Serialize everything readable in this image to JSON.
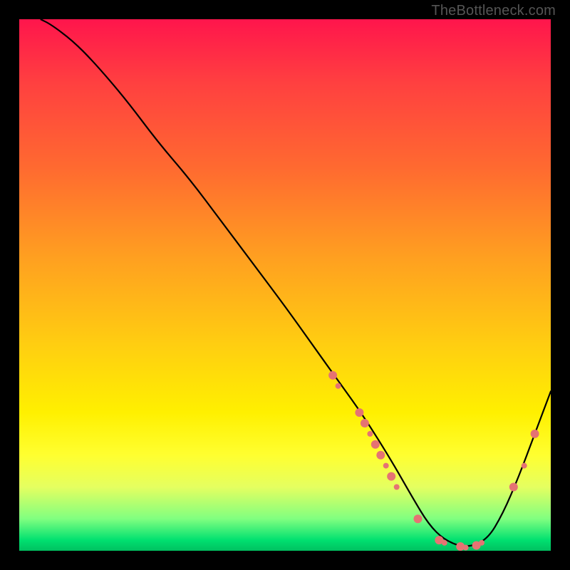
{
  "watermark": "TheBottleneck.com",
  "chart_data": {
    "type": "line",
    "title": "",
    "xlabel": "",
    "ylabel": "",
    "xlim": [
      0,
      100
    ],
    "ylim": [
      0,
      100
    ],
    "curve": {
      "name": "bottleneck-curve",
      "x": [
        4,
        6,
        10,
        14,
        20,
        26,
        32,
        38,
        44,
        50,
        55,
        60,
        65,
        70,
        74,
        77,
        80,
        84,
        88,
        91,
        94,
        97,
        100
      ],
      "y": [
        100,
        99,
        96,
        92,
        85,
        77,
        70,
        62,
        54,
        46,
        39,
        32,
        25,
        17,
        10,
        5,
        2,
        0.5,
        2,
        7,
        14,
        22,
        30
      ]
    },
    "markers": {
      "name": "highlight-dots",
      "color": "#e57373",
      "radius_small": 4,
      "radius_large": 6,
      "points": [
        {
          "x": 59,
          "y": 33,
          "r": "large"
        },
        {
          "x": 60,
          "y": 31,
          "r": "small"
        },
        {
          "x": 64,
          "y": 26,
          "r": "large"
        },
        {
          "x": 65,
          "y": 24,
          "r": "large"
        },
        {
          "x": 66,
          "y": 22,
          "r": "small"
        },
        {
          "x": 67,
          "y": 20,
          "r": "large"
        },
        {
          "x": 68,
          "y": 18,
          "r": "large"
        },
        {
          "x": 69,
          "y": 16,
          "r": "small"
        },
        {
          "x": 70,
          "y": 14,
          "r": "large"
        },
        {
          "x": 71,
          "y": 12,
          "r": "small"
        },
        {
          "x": 75,
          "y": 6,
          "r": "large"
        },
        {
          "x": 79,
          "y": 2,
          "r": "large"
        },
        {
          "x": 80,
          "y": 1.5,
          "r": "small"
        },
        {
          "x": 83,
          "y": 0.8,
          "r": "large"
        },
        {
          "x": 84,
          "y": 0.6,
          "r": "small"
        },
        {
          "x": 86,
          "y": 1,
          "r": "large"
        },
        {
          "x": 87,
          "y": 1.5,
          "r": "small"
        },
        {
          "x": 93,
          "y": 12,
          "r": "large"
        },
        {
          "x": 95,
          "y": 16,
          "r": "small"
        },
        {
          "x": 97,
          "y": 22,
          "r": "large"
        }
      ]
    }
  }
}
